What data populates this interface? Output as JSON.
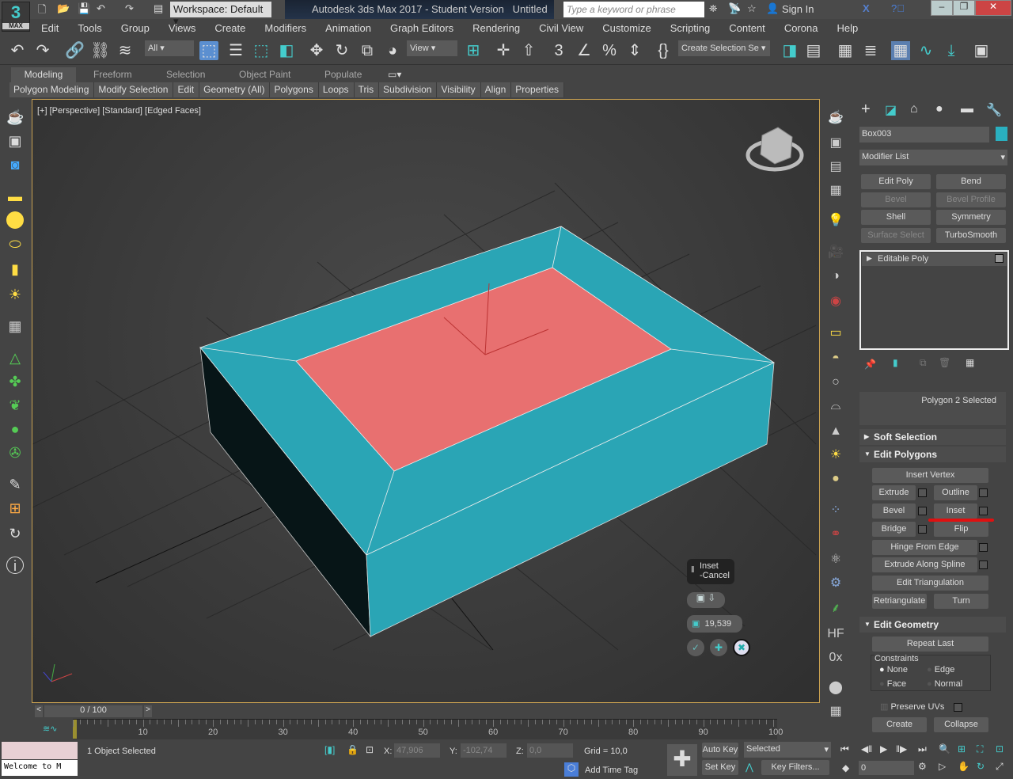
{
  "app": {
    "logo_text": "3",
    "logo_sub": "MAX",
    "workspace": "Workspace: Default",
    "title": "Autodesk 3ds Max 2017 - Student Version",
    "document": "Untitled",
    "search_placeholder": "Type a keyword or phrase",
    "sign_in": "Sign In"
  },
  "menu": [
    "Edit",
    "Tools",
    "Group",
    "Views",
    "Create",
    "Modifiers",
    "Animation",
    "Graph Editors",
    "Rendering",
    "Civil View",
    "Customize",
    "Scripting",
    "Content",
    "Corona",
    "Help"
  ],
  "toolbar": {
    "filter": "All",
    "ref_coord": "View",
    "selection_set": "Create Selection Se"
  },
  "ribbon": {
    "tabs": [
      "Modeling",
      "Freeform",
      "Selection",
      "Object Paint",
      "Populate"
    ],
    "active_tab": "Modeling",
    "panels": [
      "Polygon Modeling",
      "Modify Selection",
      "Edit",
      "Geometry (All)",
      "Polygons",
      "Loops",
      "Tris",
      "Subdivision",
      "Visibility",
      "Align",
      "Properties"
    ]
  },
  "viewport": {
    "label": "[+] [Perspective] [Standard] [Edged Faces]",
    "colors": {
      "box": "#2aa5b5",
      "selected_face": "#e87070"
    }
  },
  "caddy": {
    "title": "Inset",
    "subtitle": "-Cancel",
    "amount": "19,539"
  },
  "command_panel": {
    "object_name": "Box003",
    "object_color": "#2ab0c0",
    "modifier_list": "Modifier List",
    "modifier_buttons": [
      {
        "label": "Edit Poly",
        "enabled": true
      },
      {
        "label": "Bend",
        "enabled": true
      },
      {
        "label": "Bevel",
        "enabled": false
      },
      {
        "label": "Bevel Profile",
        "enabled": false
      },
      {
        "label": "Shell",
        "enabled": true
      },
      {
        "label": "Symmetry",
        "enabled": true
      },
      {
        "label": "Surface Select",
        "enabled": false
      },
      {
        "label": "TurboSmooth",
        "enabled": true
      }
    ],
    "stack_item": "Editable Poly",
    "selection_info": "Polygon 2 Selected",
    "soft_selection": "Soft Selection",
    "edit_polygons": "Edit Polygons",
    "ep_buttons": {
      "insert_vertex": "Insert Vertex",
      "extrude": "Extrude",
      "outline": "Outline",
      "bevel": "Bevel",
      "inset": "Inset",
      "bridge": "Bridge",
      "flip": "Flip",
      "hinge": "Hinge From Edge",
      "extrude_spline": "Extrude Along Spline",
      "edit_tri": "Edit Triangulation",
      "retriangulate": "Retriangulate",
      "turn": "Turn"
    },
    "edit_geometry": "Edit Geometry",
    "repeat_last": "Repeat Last",
    "constraints": "Constraints",
    "constraint_options": [
      "None",
      "Edge",
      "Face",
      "Normal"
    ],
    "constraint_selected": "None",
    "preserve_uvs": "Preserve UVs",
    "create": "Create",
    "collapse": "Collapse"
  },
  "timeline": {
    "frame": "0 / 100",
    "ticks": [
      "0",
      "10",
      "20",
      "30",
      "40",
      "50",
      "60",
      "70",
      "80",
      "90",
      "100"
    ]
  },
  "status": {
    "maxscript": "Welcome to M",
    "selection": "1 Object Selected",
    "x": "47,906",
    "y": "-102,74",
    "z": "0,0",
    "x_label": "X:",
    "y_label": "Y:",
    "z_label": "Z:",
    "grid": "Grid = 10,0",
    "add_time_tag": "Add Time Tag",
    "auto_key": "Auto Key",
    "set_key": "Set Key",
    "key_mode": "Selected",
    "key_filters": "Key Filters...",
    "current_frame": "0"
  }
}
